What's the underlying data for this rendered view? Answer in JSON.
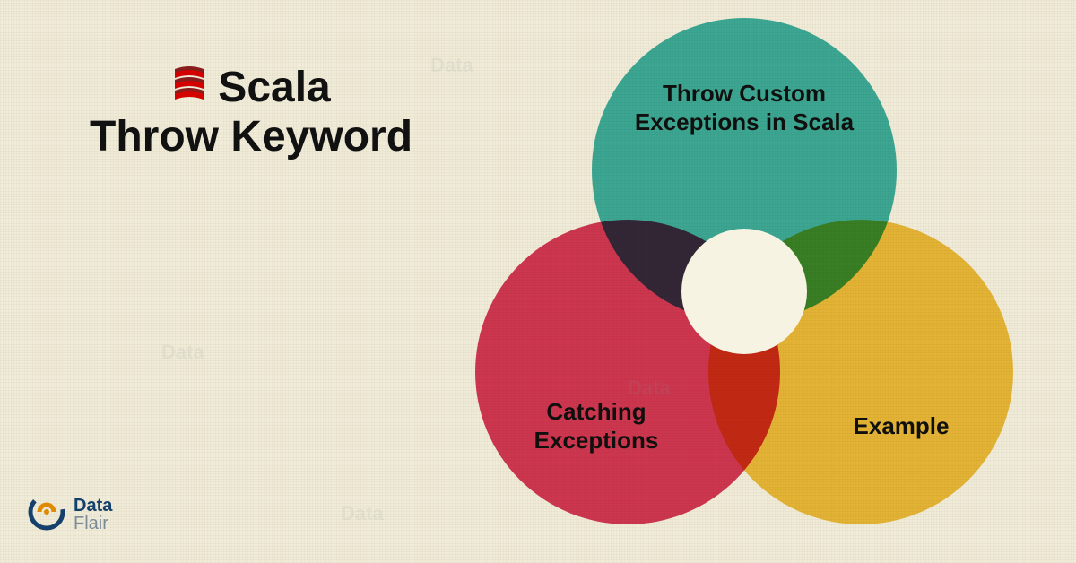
{
  "title": {
    "line1": "Scala",
    "line2": "Throw Keyword"
  },
  "venn": {
    "top": "Throw Custom\nExceptions in Scala",
    "left": "Catching\nExceptions",
    "right": "Example"
  },
  "brand": {
    "name_top": "Data",
    "name_bottom": "Flair"
  },
  "colors": {
    "teal": "#3fb4ac",
    "pink": "#d93a5d",
    "yellow": "#f2c23e"
  }
}
